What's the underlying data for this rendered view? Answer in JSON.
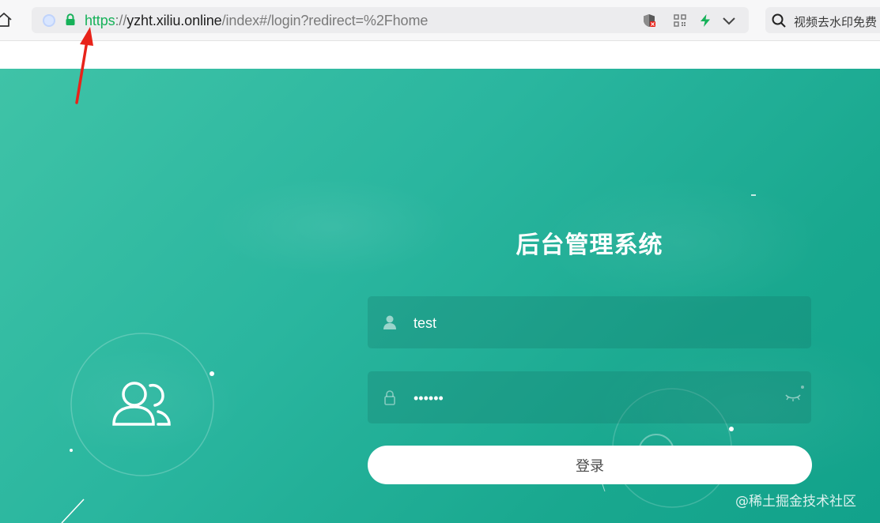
{
  "browser": {
    "url_scheme": "https",
    "url_separator": "://",
    "url_host": "yzht.xiliu.online",
    "url_path": "/index#/login?redirect=%2Fhome",
    "search_placeholder": "视频去水印免费",
    "icons": [
      "home-icon",
      "site-icon",
      "lock-icon",
      "shield-icon",
      "qr-code-icon",
      "lightning-icon",
      "chevron-down-icon",
      "search-icon"
    ]
  },
  "login": {
    "title": "后台管理系统",
    "username_value": "test",
    "password_value": "••••••",
    "submit_label": "登录"
  },
  "watermark": "@稀土掘金技术社区",
  "colors": {
    "accent_green": "#16b159",
    "background_teal": "#2ab69f",
    "arrow_red": "#e8231a"
  }
}
